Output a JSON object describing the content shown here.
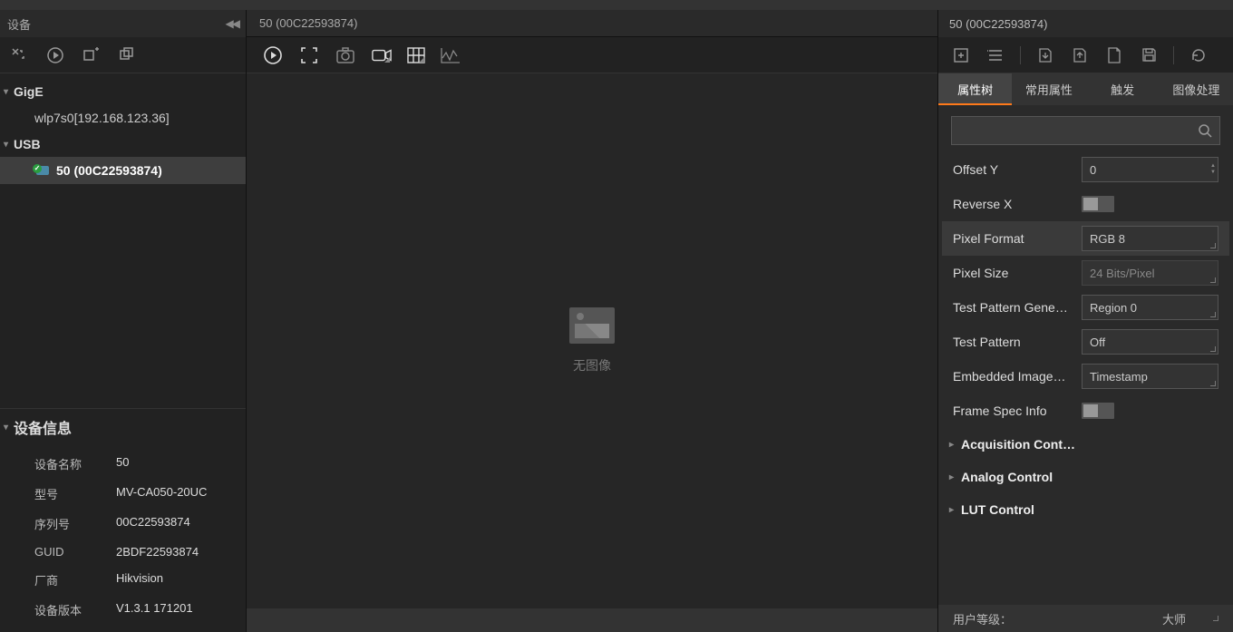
{
  "device_panel": {
    "title": "设备",
    "groups": [
      {
        "name": "GigE",
        "items": [
          "wlp7s0[192.168.123.36]"
        ]
      },
      {
        "name": "USB",
        "items": [
          "50 (00C22593874)"
        ]
      }
    ]
  },
  "device_info": {
    "title": "设备信息",
    "rows": [
      {
        "label": "设备名称",
        "value": "50"
      },
      {
        "label": "型号",
        "value": "MV-CA050-20UC"
      },
      {
        "label": "序列号",
        "value": "00C22593874"
      },
      {
        "label": "GUID",
        "value": "2BDF22593874"
      },
      {
        "label": "厂商",
        "value": "Hikvision"
      },
      {
        "label": "设备版本",
        "value": "V1.3.1 171201"
      }
    ]
  },
  "center": {
    "tab": "50 (00C22593874)",
    "placeholder": "无图像"
  },
  "right": {
    "title": "50 (00C22593874)",
    "tabs": [
      "属性树",
      "常用属性",
      "触发",
      "图像处理"
    ],
    "props": [
      {
        "label": "Offset Y",
        "type": "spin",
        "value": "0"
      },
      {
        "label": "Reverse X",
        "type": "toggle"
      },
      {
        "label": "Pixel Format",
        "type": "combo",
        "value": "RGB 8",
        "sel": true
      },
      {
        "label": "Pixel Size",
        "type": "ro",
        "value": "24 Bits/Pixel"
      },
      {
        "label": "Test Pattern Gene…",
        "type": "combo",
        "value": "Region 0"
      },
      {
        "label": "Test Pattern",
        "type": "combo",
        "value": "Off"
      },
      {
        "label": "Embedded Image…",
        "type": "combo",
        "value": "Timestamp"
      },
      {
        "label": "Frame Spec Info",
        "type": "toggle"
      }
    ],
    "groups": [
      "Acquisition Cont…",
      "Analog Control",
      "LUT Control"
    ],
    "user_level_label": "用户等级：",
    "user_level_value": "大师"
  }
}
